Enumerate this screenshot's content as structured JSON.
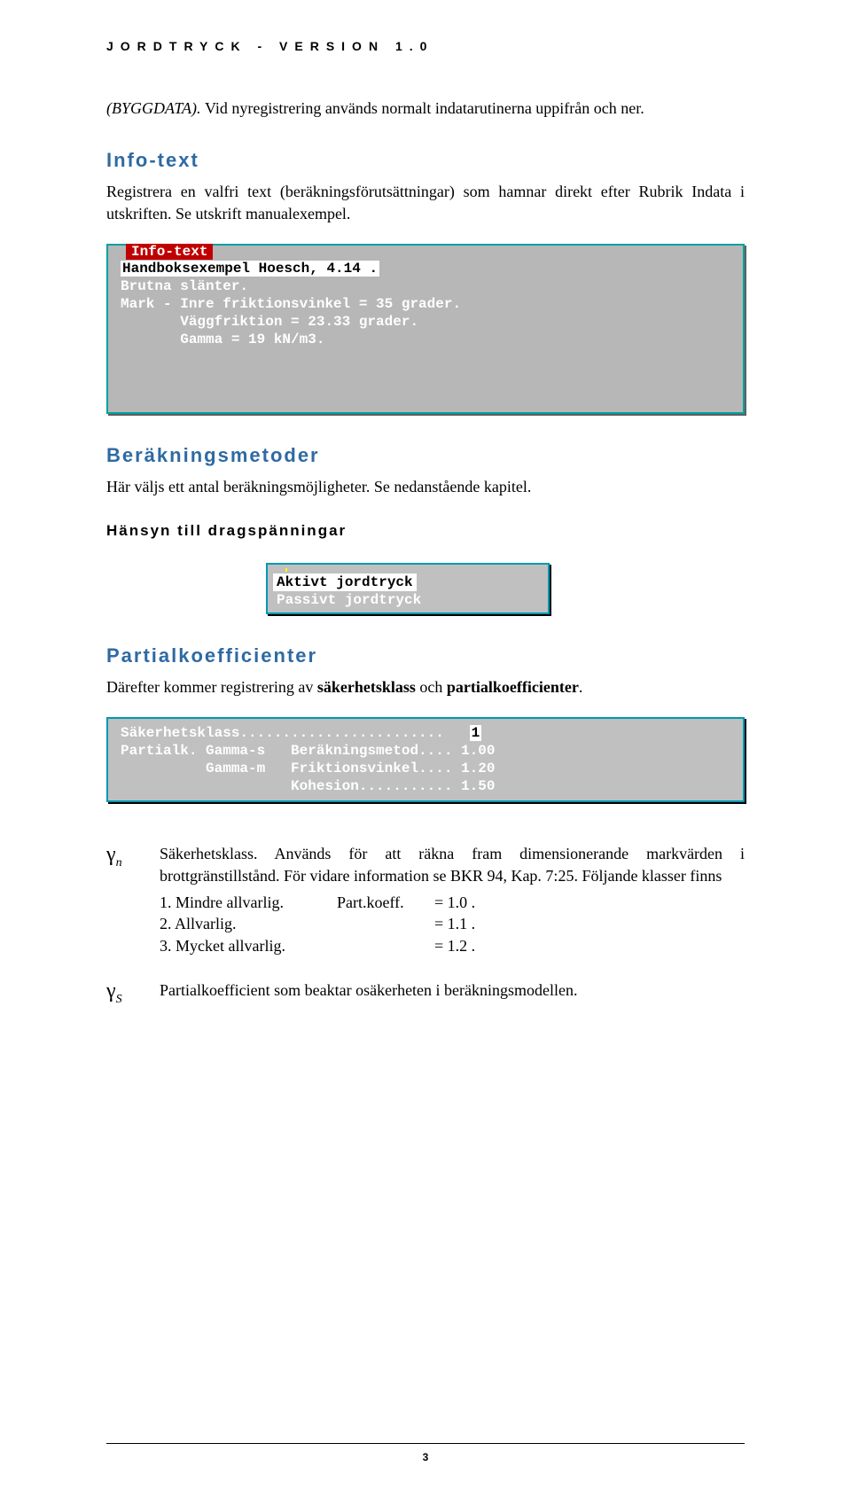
{
  "header": "JORDTRYCK - VERSION 1.0",
  "intro": {
    "prefix": "(BYGGDATA). ",
    "rest": "Vid nyregistrering används normalt indatarutinerna uppifrån och ner."
  },
  "info": {
    "title": "Info-text",
    "para": "Registrera en valfri text (beräkningsförutsättningar) som hamnar direkt efter Rubrik Indata i utskriften. Se utskrift manualexempel.",
    "term_title": "Info-text",
    "lines": [
      "Handboksexempel Hoesch, 4.14 .",
      "Brutna slänter.",
      "Mark - Inre friktionsvinkel = 35 grader.",
      "       Väggfriktion = 23.33 grader.",
      "       Gamma = 19 kN/m3."
    ]
  },
  "methods": {
    "title": "Beräkningsmetoder",
    "para": "Här väljs ett antal beräkningsmöjligheter. Se nedanstående kapitel."
  },
  "tension": {
    "title": "Hänsyn till dragspänningar",
    "menu": {
      "selected": "Aktivt  jordtryck",
      "other": "Passivt jordtryck"
    }
  },
  "partial": {
    "title": "Partialkoefficienter",
    "para_prefix": "Därefter kommer registrering av ",
    "para_b1": "säkerhetsklass",
    "para_mid": " och ",
    "para_b2": "partialkoefficienter",
    "para_suffix": ".",
    "lines": [
      {
        "l": "Säkerhetsklass",
        "dots": "........................",
        "v": "1"
      },
      {
        "l": "Partialk. Gamma-s   Beräkningsmetod",
        "dots": "....",
        "v": "1.00"
      },
      {
        "l": "          Gamma-m   Friktionsvinkel",
        "dots": "....",
        "v": "1.20"
      },
      {
        "l": "                    Kohesion",
        "dots": "...........",
        "v": "1.50"
      }
    ]
  },
  "gamma_n": {
    "symbol": "γ",
    "sub": "n",
    "text": "Säkerhetsklass. Används för att räkna fram dimensionerande markvärden i brottgränstillstånd. För vidare information se BKR 94, Kap. 7:25. Följande klasser finns",
    "rows": [
      {
        "c1": "1. Mindre allvarlig.",
        "c2": "Part.koeff.",
        "c3": "= 1.0 ."
      },
      {
        "c1": "2. Allvarlig.",
        "c2": "",
        "c3": "= 1.1 ."
      },
      {
        "c1": "3. Mycket allvarlig.",
        "c2": "",
        "c3": "= 1.2 ."
      }
    ]
  },
  "gamma_s": {
    "symbol": "γ",
    "sub": "S",
    "text": "Partialkoefficient som beaktar osäkerheten i beräkningsmodellen."
  },
  "pagenum": "3"
}
